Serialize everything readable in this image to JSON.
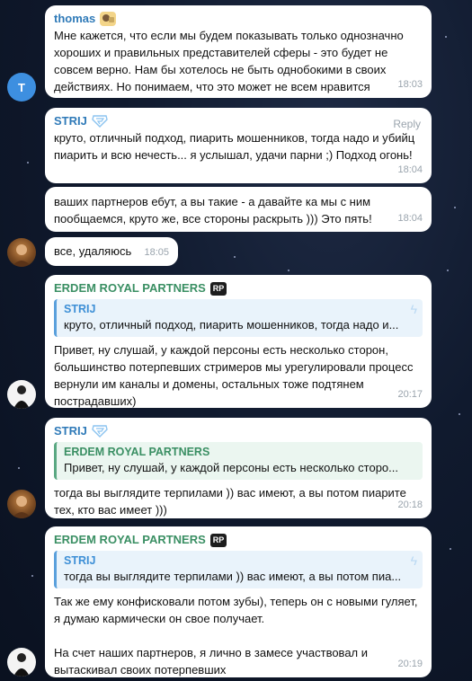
{
  "messages": [
    {
      "sender": "thomas",
      "avatar_letter": "T",
      "text": "Мне кажется, что если мы будем показывать только однозначно хороших и правильных представителей сферы - это будет не совсем верно. Нам бы хотелось не быть однобокими в своих действиях. Но понимаем, что это может не всем нравится",
      "time": "18:03"
    },
    {
      "sender": "STRIJ",
      "reply_label": "Reply",
      "text": "круто, отличный подход, пиарить мошенников, тогда надо и убийц пиарить и всю нечесть... я услышал, удачи парни ;) Подход огонь!",
      "time": "18:04"
    },
    {
      "text": "ваших партнеров ебут, а вы такие - а давайте ка мы с ним пообщаемся, круто же, все стороны раскрыть ))) Это пять!",
      "time": "18:04"
    },
    {
      "text": "все, удаляюсь",
      "time": "18:05"
    },
    {
      "sender": "ERDEM ROYAL PARTNERS",
      "badge": "RP",
      "quote": {
        "name": "STRIJ",
        "text": "круто, отличный подход, пиарить мошенников, тогда надо и..."
      },
      "text": "Привет, ну слушай, у каждой персоны есть несколько сторон, большинство потерпевших стримеров мы урегулировали процесс вернули им каналы и домены, остальных тоже подтянем пострадавших)",
      "time": "20:17"
    },
    {
      "sender": "STRIJ",
      "quote": {
        "name": "ERDEM ROYAL PARTNERS",
        "text": "Привет, ну слушай, у каждой персоны есть несколько сторо..."
      },
      "text": "тогда вы выглядите терпилами )) вас имеют, а вы потом пиарите тех, кто вас имеет )))",
      "time": "20:18"
    },
    {
      "sender": "ERDEM ROYAL PARTNERS",
      "badge": "RP",
      "quote": {
        "name": "STRIJ",
        "text": "тогда вы выглядите терпилами )) вас имеют, а вы потом пиа..."
      },
      "text": "Так же ему конфисковали потом зубы), теперь он с новыми гуляет, я думаю кармически он свое получает.\n\nНа счет наших партнеров, я лично в замесе участвовал и вытаскивал своих потерпевших",
      "time": "20:19"
    }
  ],
  "icons": {
    "strij_badge": "superman-shield-icon",
    "thomas_badge": "sticker-emoji-icon",
    "quote_decoration": "lightning-bolt-icon"
  },
  "colors": {
    "background": "#101a2e",
    "bubble": "#ffffff",
    "name_green": "#3a8f63",
    "name_blue": "#2f7ab8",
    "quote_accent": "#5aa0dc",
    "time": "#9aa4ad"
  }
}
